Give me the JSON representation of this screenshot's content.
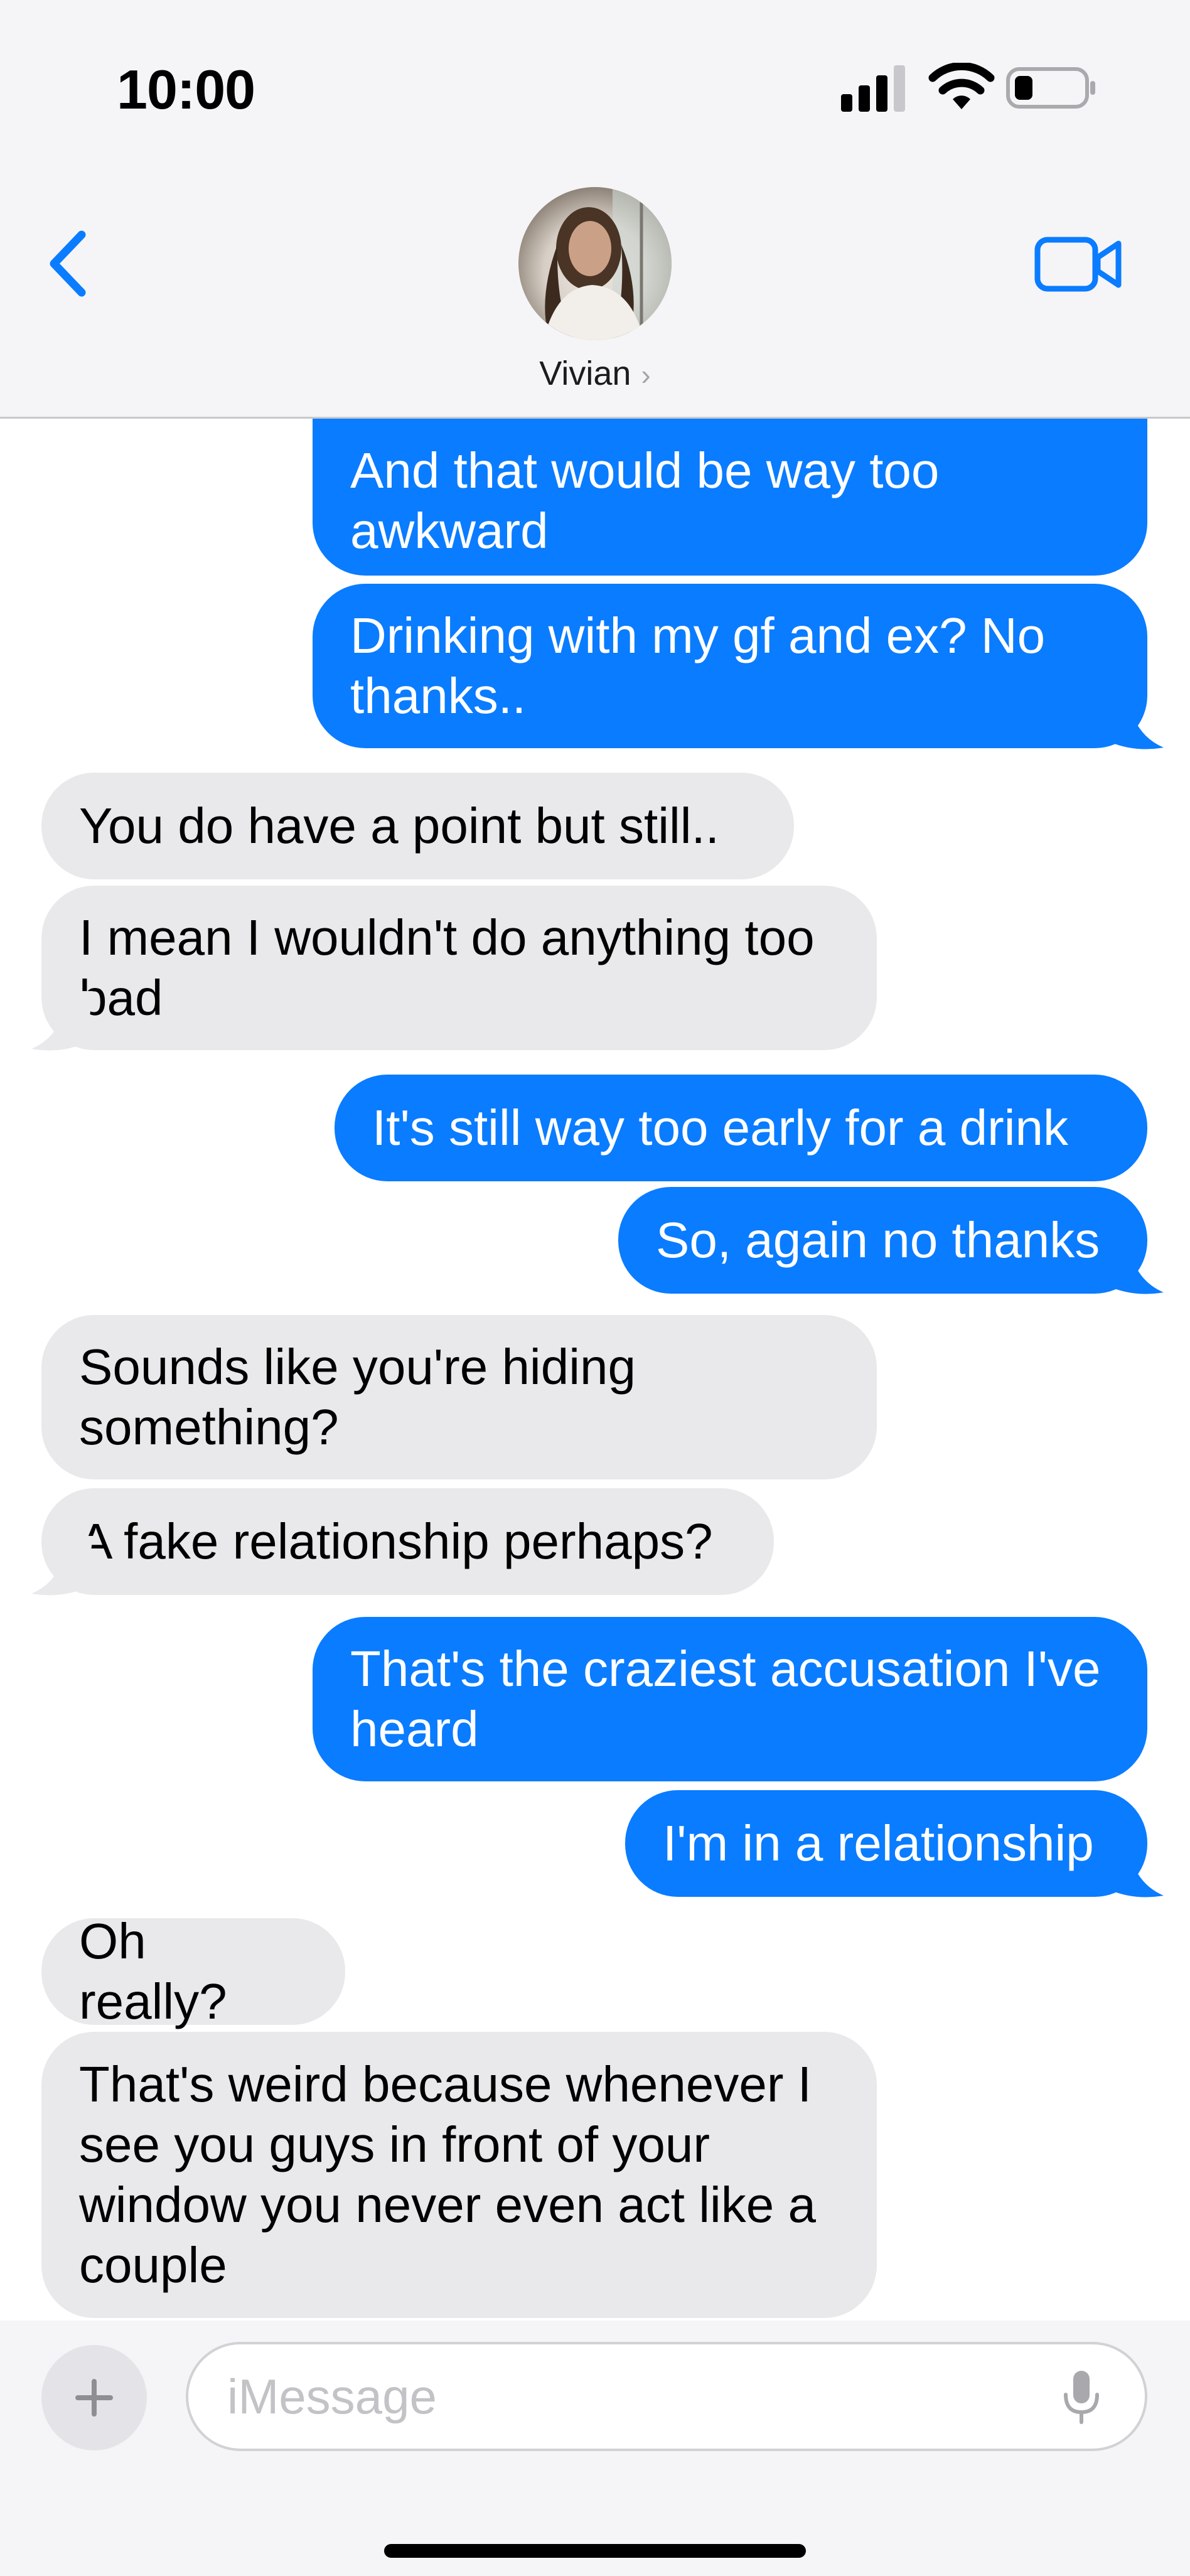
{
  "status_bar": {
    "time": "10:00"
  },
  "header": {
    "contact_name": "Vivian",
    "chevron": "›"
  },
  "messages": [
    {
      "from": "me",
      "text": "And that would be way too awkward"
    },
    {
      "from": "me",
      "text": "Drinking with my gf and ex? No thanks.."
    },
    {
      "from": "them",
      "text": "You do have a point but still.."
    },
    {
      "from": "them",
      "text": "I mean I wouldn't do anything too bad"
    },
    {
      "from": "me",
      "text": "It's still way too early for a drink"
    },
    {
      "from": "me",
      "text": "So, again no thanks"
    },
    {
      "from": "them",
      "text": "Sounds like you're hiding something?"
    },
    {
      "from": "them",
      "text": "A fake relationship perhaps?"
    },
    {
      "from": "me",
      "text": "That's the craziest accusation I've heard"
    },
    {
      "from": "me",
      "text": "I'm in a relationship"
    },
    {
      "from": "them",
      "text": "Oh really?"
    },
    {
      "from": "them",
      "text": "That's weird because whenever I see you guys in front of your window you never even act like a couple"
    }
  ],
  "composer": {
    "placeholder": "iMessage",
    "plus": "+"
  },
  "colors": {
    "sent": "#0a7cff",
    "received": "#e9e9eb",
    "accent": "#0a7cff"
  },
  "icons": {
    "back": "chevron-left-icon",
    "video": "video-camera-icon",
    "mic": "microphone-icon"
  }
}
